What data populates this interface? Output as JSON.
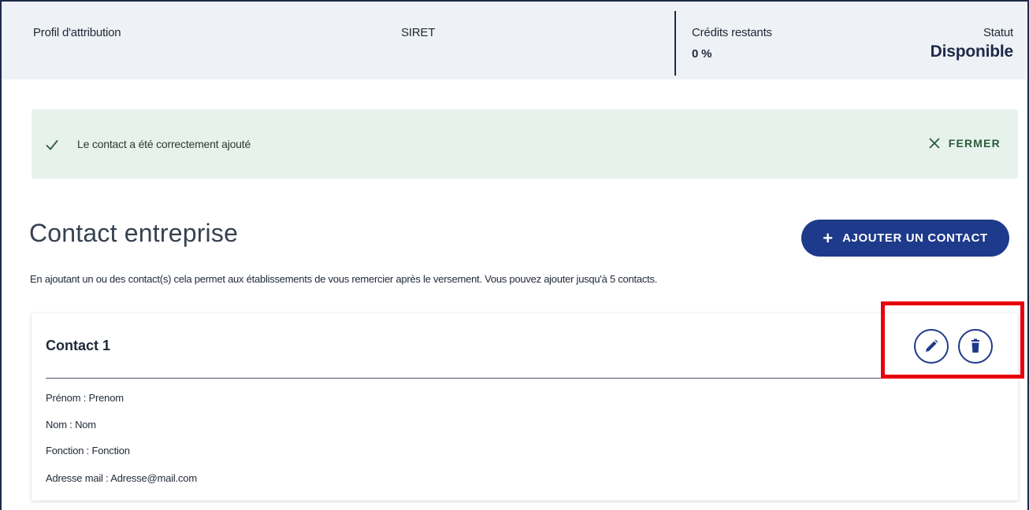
{
  "header": {
    "profil_label": "Profil d'attribution",
    "siret_label": "SIRET",
    "credits_label": "Crédits restants",
    "credits_value": "0 %",
    "statut_label": "Statut",
    "statut_value": "Disponible"
  },
  "alert": {
    "message": "Le contact a été correctement ajouté",
    "close_label": "FERMER",
    "check_icon": "check-icon",
    "close_icon": "close-icon"
  },
  "section": {
    "title": "Contact entreprise",
    "add_button_label": "AJOUTER UN CONTACT",
    "add_button_icon": "plus-icon",
    "description": "En ajoutant un ou des contact(s) cela permet aux établissements de vous remercier après le versement. Vous pouvez ajouter jusqu'à 5 contacts."
  },
  "contact": {
    "title": "Contact 1",
    "fields": [
      "Prénom : Prenom",
      "Nom : Nom",
      "Fonction : Fonction",
      "Adresse mail : Adresse@mail.com"
    ],
    "edit_icon": "pencil-icon",
    "delete_icon": "trash-icon"
  },
  "colors": {
    "primary": "#1e3a8a",
    "alert_bg": "#e8f2ec",
    "highlight": "#e8000d"
  }
}
